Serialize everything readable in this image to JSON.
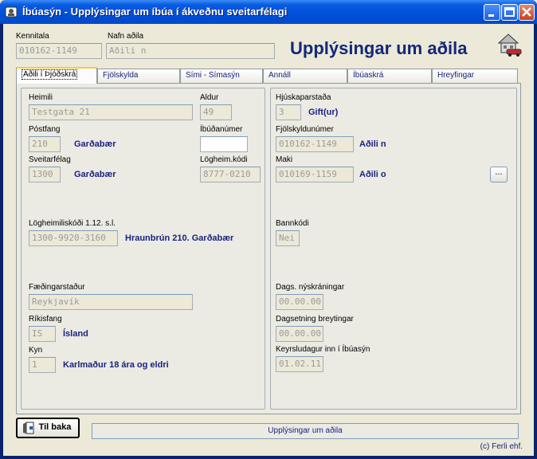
{
  "window": {
    "title": "Íbúasýn - Upplýsingar um íbúa í ákveðnu sveitarfélagi"
  },
  "header": {
    "kennitala_label": "Kennitala",
    "kennitala_value": "010162-1149",
    "nafn_label": "Nafn aðila",
    "nafn_value": "Aðili n",
    "big_title": "Upplýsingar um aðila"
  },
  "tabs": [
    {
      "label": "Aðili í Þjóðskrá"
    },
    {
      "label": "Fjölskylda"
    },
    {
      "label": "Sími - Símasýn"
    },
    {
      "label": "Annáll"
    },
    {
      "label": "Íbúaskrá"
    },
    {
      "label": "Hreyfingar"
    }
  ],
  "left": {
    "heimili_label": "Heimili",
    "heimili_value": "Testgata 21",
    "aldur_label": "Aldur",
    "aldur_value": "49",
    "postfang_label": "Póstfang",
    "postfang_value": "210",
    "postfang_name": "Garðabær",
    "ibudanumer_label": "Íbúðanúmer",
    "ibudanumer_value": "",
    "sveitarfelag_label": "Sveitarfélag",
    "sveitarfelag_value": "1300",
    "sveitarfelag_name": "Garðabær",
    "logheim_label": "Lögheim.kódi",
    "logheim_value": "8777-0210",
    "logheimiliskodi_label": "Lögheimiliskóði 1.12. s.l.",
    "logheimiliskodi_value": "1300-9920-3160",
    "logheimiliskodi_text": "Hraunbrún 210. Garðabær",
    "faedingarstadur_label": "Fæðingarstaður",
    "faedingarstadur_value": "Reykjavík",
    "rikisfang_label": "Ríkisfang",
    "rikisfang_value": "IS",
    "rikisfang_name": "Ísland",
    "kyn_label": "Kyn",
    "kyn_value": "1",
    "kyn_text": "Karlmaður 18 ára og eldri"
  },
  "right": {
    "hjuskapar_label": "Hjúskaparstaða",
    "hjuskapar_value": "3",
    "hjuskapar_text": "Gift(ur)",
    "fjolskyldunumer_label": "Fjölskyldunúmer",
    "fjolskyldunumer_value": "010162-1149",
    "fjolskyldunumer_name": "Aðili n",
    "maki_label": "Maki",
    "maki_value": "010169-1159",
    "maki_name": "Aðili o",
    "maki_button": "...",
    "bannkodi_label": "Bannkódi",
    "bannkodi_value": "Nei",
    "dags_label": "Dags. nýskráningar",
    "dags_value": "00.00.00",
    "breyting_label": "Dagsetning breytingar",
    "breyting_value": "00.00.00",
    "keyrsla_label": "Keyrsludagur inn í Íbúasýn",
    "keyrsla_value": "01.02.11"
  },
  "footer": {
    "back_button": "Til baka",
    "status": "Upplýsingar um aðila",
    "copyright": "(c) Ferli ehf."
  }
}
